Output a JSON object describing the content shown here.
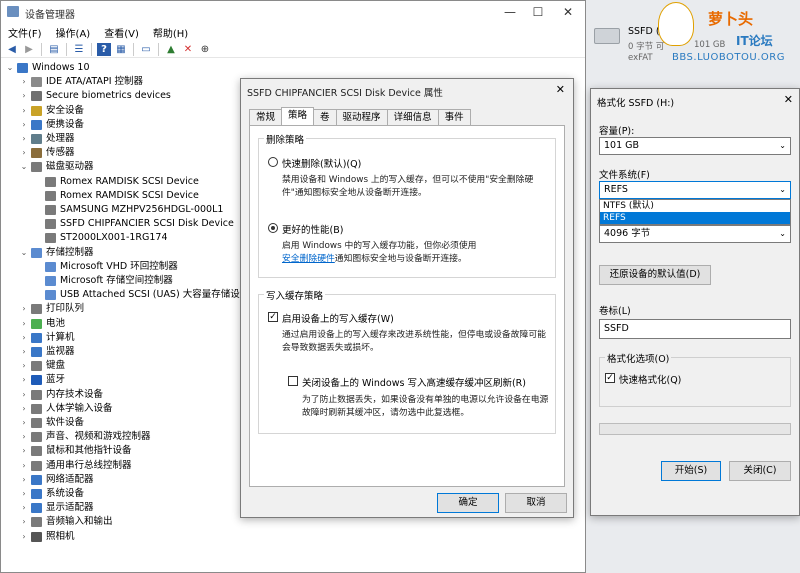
{
  "device_manager": {
    "title": "设备管理器",
    "window_controls": [
      "—",
      "☐",
      "✕"
    ],
    "menu": [
      "文件(F)",
      "操作(A)",
      "查看(V)",
      "帮助(H)"
    ],
    "tree": [
      {
        "level": 0,
        "exp": "⌄",
        "label": "Windows 10",
        "color": "#3a77c7"
      },
      {
        "level": 1,
        "exp": "›",
        "label": "IDE ATA/ATAPI 控制器",
        "color": "#8a8a8a"
      },
      {
        "level": 1,
        "exp": "›",
        "label": "Secure biometrics devices",
        "color": "#707070"
      },
      {
        "level": 1,
        "exp": "›",
        "label": "安全设备",
        "color": "#c9a227"
      },
      {
        "level": 1,
        "exp": "›",
        "label": "便携设备",
        "color": "#3a77c7"
      },
      {
        "level": 1,
        "exp": "›",
        "label": "处理器",
        "color": "#607d8b"
      },
      {
        "level": 1,
        "exp": "›",
        "label": "传感器",
        "color": "#8a6d3b"
      },
      {
        "level": 1,
        "exp": "⌄",
        "label": "磁盘驱动器",
        "color": "#7a7a7a"
      },
      {
        "level": 2,
        "exp": "",
        "label": "Romex RAMDISK SCSI Device",
        "color": "#7a7a7a"
      },
      {
        "level": 2,
        "exp": "",
        "label": "Romex RAMDISK SCSI Device",
        "color": "#7a7a7a"
      },
      {
        "level": 2,
        "exp": "",
        "label": "SAMSUNG MZHPV256HDGL-000L1",
        "color": "#7a7a7a"
      },
      {
        "level": 2,
        "exp": "",
        "label": "SSFD CHIPFANCIER SCSI Disk Device",
        "color": "#7a7a7a"
      },
      {
        "level": 2,
        "exp": "",
        "label": "ST2000LX001-1RG174",
        "color": "#7a7a7a"
      },
      {
        "level": 1,
        "exp": "⌄",
        "label": "存储控制器",
        "color": "#5b8bd0"
      },
      {
        "level": 2,
        "exp": "",
        "label": "Microsoft VHD 环回控制器",
        "color": "#5b8bd0"
      },
      {
        "level": 2,
        "exp": "",
        "label": "Microsoft 存储空间控制器",
        "color": "#5b8bd0"
      },
      {
        "level": 2,
        "exp": "",
        "label": "USB Attached SCSI (UAS) 大容量存储设备",
        "color": "#5b8bd0"
      },
      {
        "level": 1,
        "exp": "›",
        "label": "打印队列",
        "color": "#7a7a7a"
      },
      {
        "level": 1,
        "exp": "›",
        "label": "电池",
        "color": "#4caf50"
      },
      {
        "level": 1,
        "exp": "›",
        "label": "计算机",
        "color": "#3a77c7"
      },
      {
        "level": 1,
        "exp": "›",
        "label": "监视器",
        "color": "#3a77c7"
      },
      {
        "level": 1,
        "exp": "›",
        "label": "键盘",
        "color": "#7a7a7a"
      },
      {
        "level": 1,
        "exp": "›",
        "label": "蓝牙",
        "color": "#1e5bb8"
      },
      {
        "level": 1,
        "exp": "›",
        "label": "内存技术设备",
        "color": "#7a7a7a"
      },
      {
        "level": 1,
        "exp": "›",
        "label": "人体学输入设备",
        "color": "#7a7a7a"
      },
      {
        "level": 1,
        "exp": "›",
        "label": "软件设备",
        "color": "#7a7a7a"
      },
      {
        "level": 1,
        "exp": "›",
        "label": "声音、视频和游戏控制器",
        "color": "#7a7a7a"
      },
      {
        "level": 1,
        "exp": "›",
        "label": "鼠标和其他指针设备",
        "color": "#7a7a7a"
      },
      {
        "level": 1,
        "exp": "›",
        "label": "通用串行总线控制器",
        "color": "#7a7a7a"
      },
      {
        "level": 1,
        "exp": "›",
        "label": "网络适配器",
        "color": "#3a77c7"
      },
      {
        "level": 1,
        "exp": "›",
        "label": "系统设备",
        "color": "#3a77c7"
      },
      {
        "level": 1,
        "exp": "›",
        "label": "显示适配器",
        "color": "#3a77c7"
      },
      {
        "level": 1,
        "exp": "›",
        "label": "音频输入和输出",
        "color": "#7a7a7a"
      },
      {
        "level": 1,
        "exp": "›",
        "label": "照相机",
        "color": "#555555"
      }
    ]
  },
  "properties": {
    "title": "SSFD CHIPFANCIER SCSI Disk Device 属性",
    "close": "✕",
    "tabs": [
      "常规",
      "策略",
      "卷",
      "驱动程序",
      "详细信息",
      "事件"
    ],
    "active_tab": "策略",
    "removal_group": "删除策略",
    "quick_label": "快速删除(默认)(Q)",
    "quick_desc": "禁用设备和 Windows 上的写入缓存，但可以不使用\"安全删除硬件\"通知图标安全地从设备断开连接。",
    "better_label": "更好的性能(B)",
    "better_desc_1": "启用 Windows 中的写入缓存功能，但你必须使用",
    "better_link": "安全删除硬件",
    "better_desc_2": "通知图标安全地与设备断开连接。",
    "cache_group": "写入缓存策略",
    "enable_cache_label": "启用设备上的写入缓存(W)",
    "enable_cache_desc": "通过启用设备上的写入缓存来改进系统性能，但停电或设备故障可能会导致数据丢失或损坏。",
    "flush_label": "关闭设备上的 Windows 写入高速缓存缓冲区刷新(R)",
    "flush_desc": "为了防止数据丢失，如果设备没有单独的电源以允许设备在电源故障时刷新其缓冲区，请勿选中此复选框。",
    "ok": "确定",
    "cancel": "取消"
  },
  "drive": {
    "name": "SSFD (H:)",
    "free": "0 字节 可",
    "size": "101 GB",
    "fs": "exFAT",
    "watermark_1": "萝卜头",
    "watermark_2": "IT论坛",
    "watermark_url": "BBS.LUOBOTOU.ORG"
  },
  "format": {
    "title": "格式化 SSFD (H:)",
    "close": "✕",
    "capacity_label": "容量(P):",
    "capacity_value": "101 GB",
    "fs_label": "文件系统(F)",
    "fs_value": "REFS",
    "fs_options": [
      "NTFS (默认)",
      "REFS"
    ],
    "alloc_value": "4096 字节",
    "restore_btn": "还原设备的默认值(D)",
    "volume_label": "卷标(L)",
    "volume_value": "SSFD",
    "options_group": "格式化选项(O)",
    "quick_format": "快速格式化(Q)",
    "start_btn": "开始(S)",
    "close_btn": "关闭(C)"
  }
}
